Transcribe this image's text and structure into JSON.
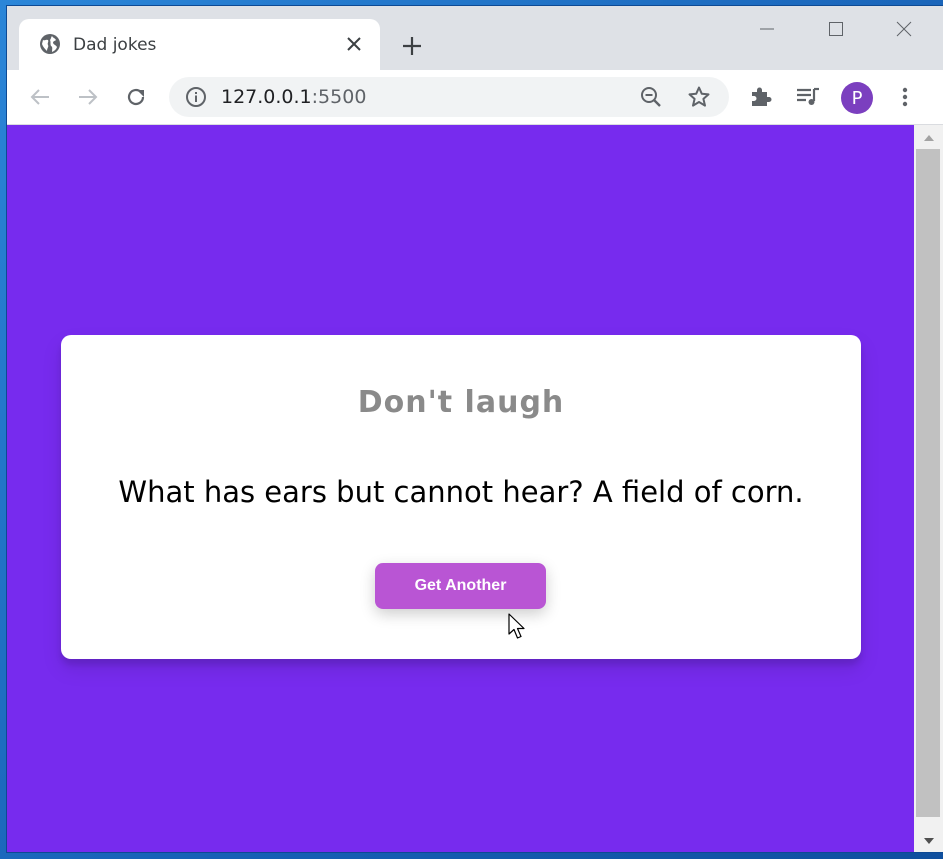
{
  "browser": {
    "tab_title": "Dad jokes",
    "url_host": "127.0.0.1",
    "url_port": ":5500",
    "profile_initial": "P",
    "icons": {
      "tab": "globe-icon",
      "close": "close-icon",
      "new_tab": "plus-icon",
      "back": "arrow-left-icon",
      "forward": "arrow-right-icon",
      "reload": "reload-icon",
      "info": "info-icon",
      "zoom": "zoom-out-icon",
      "bookmark": "star-icon",
      "extensions": "puzzle-icon",
      "media": "playlist-icon",
      "menu": "kebab-menu-icon"
    },
    "colors": {
      "avatar": "#7b3fbf"
    }
  },
  "page": {
    "background_color": "#772bee",
    "heading": "Don't laugh",
    "joke": "What has ears but cannot hear? A field of corn.",
    "button_label": "Get Another",
    "button_color": "#b955d4"
  }
}
